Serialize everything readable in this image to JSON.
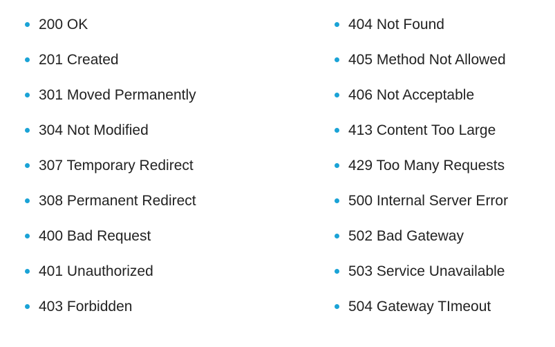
{
  "colors": {
    "bullet": "#1aa3d6",
    "text": "#222222"
  },
  "left_column": {
    "items": [
      "200 OK",
      "201 Created",
      "301 Moved Permanently",
      "304 Not Modified",
      "307 Temporary Redirect",
      "308 Permanent Redirect",
      "400 Bad Request",
      "401 Unauthorized",
      "403 Forbidden"
    ]
  },
  "right_column": {
    "items": [
      "404 Not Found",
      "405 Method Not Allowed",
      "406 Not Acceptable",
      "413 Content Too Large",
      "429 Too Many Requests",
      "500 Internal Server Error",
      "502 Bad Gateway",
      "503 Service Unavailable",
      "504 Gateway TImeout"
    ]
  }
}
